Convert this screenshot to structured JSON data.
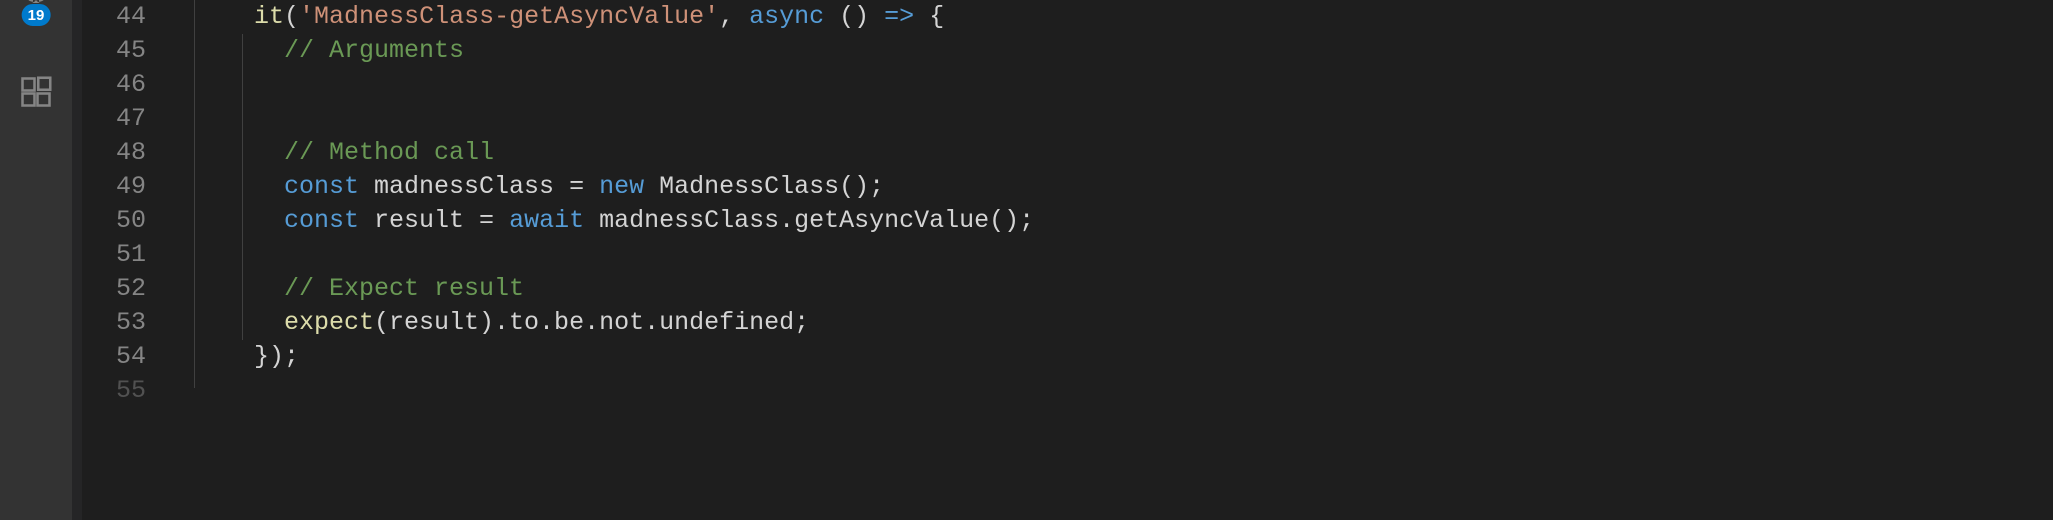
{
  "activity_bar": {
    "source_control_badge": "19"
  },
  "lines": {
    "l44": {
      "num": "44",
      "t1": "it",
      "t2": "(",
      "t3": "'MadnessClass-getAsyncValue'",
      "t4": ", ",
      "t5": "async",
      "t6": " () ",
      "t7": "=>",
      "t8": " {"
    },
    "l45": {
      "num": "45",
      "t1": "// Arguments"
    },
    "l46": {
      "num": "46"
    },
    "l47": {
      "num": "47"
    },
    "l48": {
      "num": "48",
      "t1": "// Method call"
    },
    "l49": {
      "num": "49",
      "t1": "const",
      "t2": " madnessClass = ",
      "t3": "new",
      "t4": " ",
      "t5": "MadnessClass",
      "t6": "();"
    },
    "l50": {
      "num": "50",
      "t1": "const",
      "t2": " result = ",
      "t3": "await",
      "t4": " madnessClass.",
      "t5": "getAsyncValue",
      "t6": "();"
    },
    "l51": {
      "num": "51"
    },
    "l52": {
      "num": "52",
      "t1": "// Expect result"
    },
    "l53": {
      "num": "53",
      "t1": "expect",
      "t2": "(result).to.be.not.undefined;"
    },
    "l54": {
      "num": "54",
      "t1": "});"
    },
    "l55": {
      "num": "55"
    }
  },
  "indent": {
    "lvl1": "    ",
    "lvl2": "      "
  }
}
